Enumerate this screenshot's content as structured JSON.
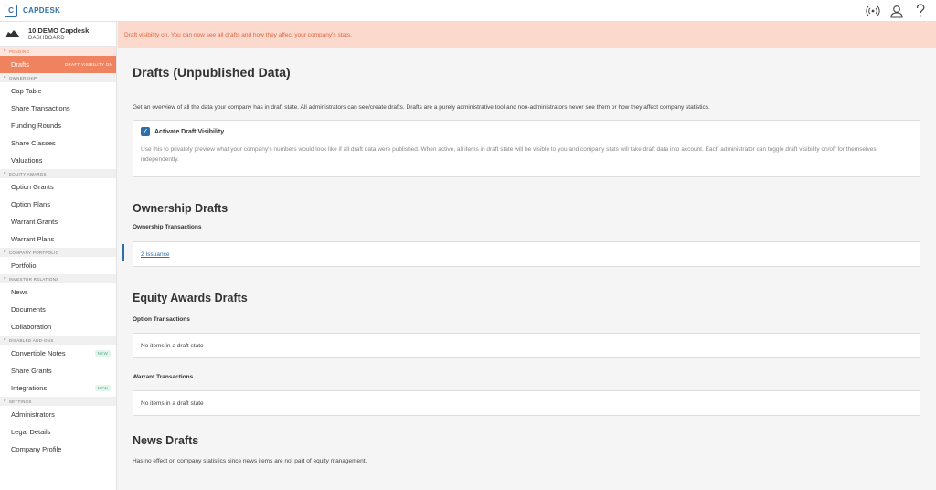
{
  "app": {
    "logo_letter": "C",
    "name": "CAPDESK"
  },
  "header_icons": [
    "broadcast-icon",
    "user-icon",
    "help-icon"
  ],
  "company": {
    "name": "10 DEMO Capdesk",
    "subtitle": "DASHBOARD"
  },
  "sidebar": {
    "pending": {
      "header": "PENDING",
      "items": [
        {
          "label": "Drafts",
          "tag": "DRAFT VISIBILITY ON"
        }
      ]
    },
    "ownership": {
      "header": "OWNERSHIP",
      "items": [
        "Cap Table",
        "Share Transactions",
        "Funding Rounds",
        "Share Classes",
        "Valuations"
      ]
    },
    "equity": {
      "header": "EQUITY AWARDS",
      "items": [
        "Option Grants",
        "Option Plans",
        "Warrant Grants",
        "Warrant Plans"
      ]
    },
    "portfolio": {
      "header": "COMPANY PORTFOLIO",
      "items": [
        "Portfolio"
      ]
    },
    "investor": {
      "header": "INVESTOR RELATIONS",
      "items": [
        "News",
        "Documents",
        "Collaboration"
      ]
    },
    "addons": {
      "header": "DISABLED ADD-ONS",
      "items": [
        {
          "label": "Convertible Notes",
          "badge": "NEW"
        },
        {
          "label": "Share Grants",
          "badge": ""
        },
        {
          "label": "Integrations",
          "badge": "NEW"
        }
      ]
    },
    "settings": {
      "header": "SETTINGS",
      "items": [
        "Administrators",
        "Legal Details",
        "Company Profile"
      ]
    }
  },
  "banner": "Draft visibility on. You can now see all drafts and how they affect your company's stats.",
  "page": {
    "title": "Drafts (Unpublished Data)",
    "intro": "Get an overview of all the data your company has in draft state. All administrators can see/create drafts. Drafts are a purely administrative tool and non-administrators never see them or how they affect company statistics.",
    "toggle": {
      "checked": true,
      "label": "Activate Draft Visibility",
      "description": "Use this to privately preview what your company's numbers would look like if all draft data were published. When active, all items in draft state will be visible to you and company stats will take draft data into account. Each administrator can toggle draft visibility on/off for themselves independently."
    }
  },
  "ownership_drafts": {
    "title": "Ownership Drafts",
    "subtitle": "Ownership Transactions",
    "link": "2 Issuance"
  },
  "equity_drafts": {
    "title": "Equity Awards Drafts",
    "option_subtitle": "Option Transactions",
    "option_empty": "No items in a draft state",
    "warrant_subtitle": "Warrant Transactions",
    "warrant_empty": "No items in a draft state"
  },
  "news_drafts": {
    "title": "News Drafts",
    "note": "Has no effect on company statistics since news items are not part of equity management."
  },
  "colors": {
    "accent": "#2f6fa5",
    "active_nav": "#f0835f",
    "banner_bg": "#fbd9cd",
    "banner_text": "#e2653f"
  }
}
